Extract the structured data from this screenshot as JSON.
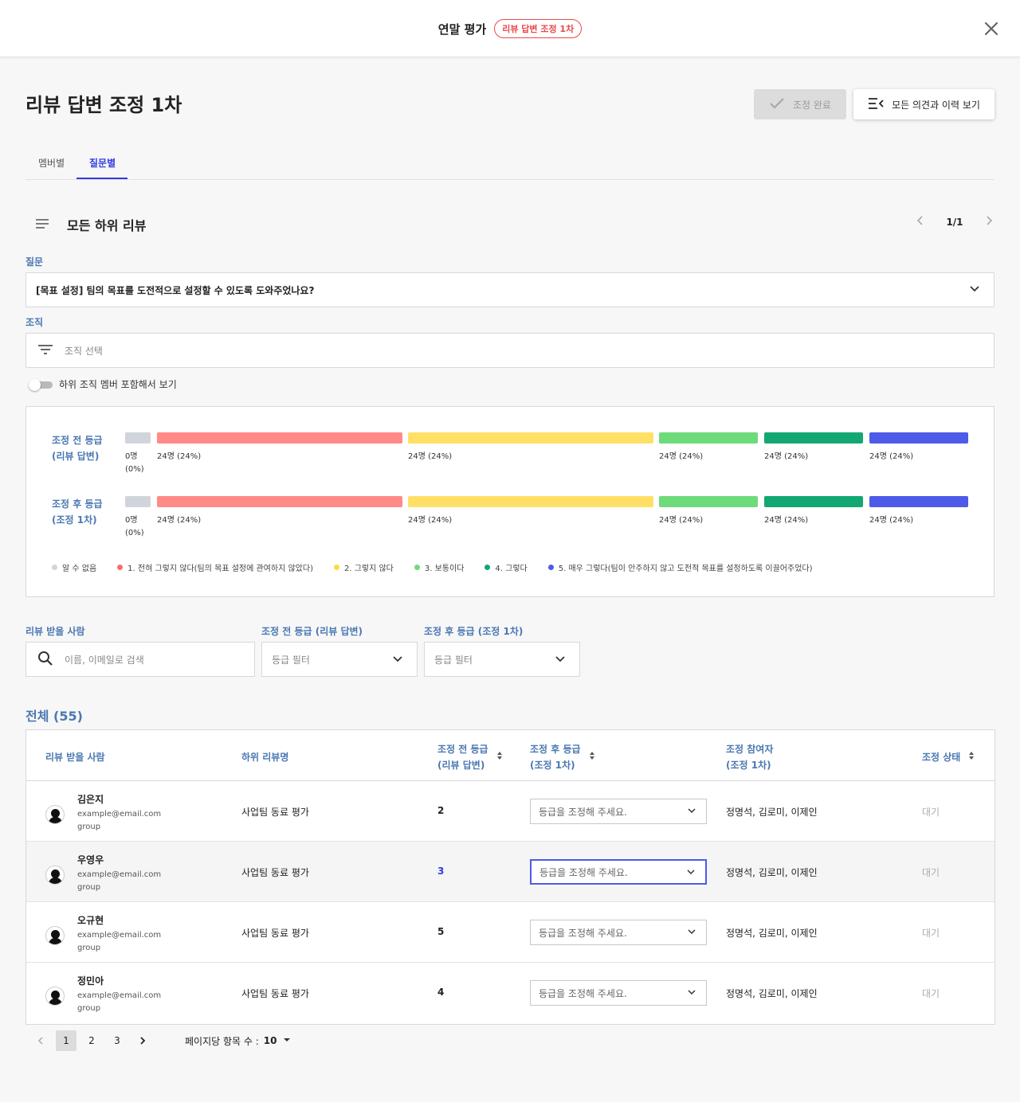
{
  "header": {
    "app_title": "연말 평가",
    "round_badge": "리뷰 답변 조정 1차"
  },
  "page": {
    "title": "리뷰 답변 조정 1차",
    "complete_button": "조정 완료",
    "history_button": "모든 의견과 이력 보기"
  },
  "tabs": [
    {
      "label": "멤버별",
      "active": false
    },
    {
      "label": "질문별",
      "active": true
    }
  ],
  "section": {
    "title": "모든 하위 리뷰",
    "pager": "1/1"
  },
  "question": {
    "label": "질문",
    "value": "[목표 설정] 팀의 목표를 도전적으로 설정할 수 있도록 도와주었나요?"
  },
  "org": {
    "label": "조직",
    "placeholder": "조직 선택",
    "toggle_label": "하위 조직 멤버 포함해서 보기",
    "toggle_on": false
  },
  "distribution": {
    "rows": [
      {
        "label_line1": "조정 전 등급",
        "label_line2": "(리뷰 답변)"
      },
      {
        "label_line1": "조정 후 등급",
        "label_line2": "(조정 1차)"
      }
    ],
    "segments": [
      {
        "label": "알 수 없음",
        "color": "#d1d5db",
        "count_label": "0명",
        "pct_label": "(0%)"
      },
      {
        "label": "1. 전혀 그렇지 않다(팀의 목표 설정에 관여하지 않았다)",
        "color": "#ff8a87",
        "count_label": "24명 (24%)"
      },
      {
        "label": "2. 그렇지 않다",
        "color": "#ffe066",
        "count_label": "24명 (24%)"
      },
      {
        "label": "3. 보통이다",
        "color": "#6edb7b",
        "count_label": "24명 (24%)"
      },
      {
        "label": "4. 그렇다",
        "color": "#13a873",
        "count_label": "24명 (24%)"
      },
      {
        "label": "5. 매우 그렇다(팀이 안주하지 않고 도전적 목표를 설정하도록 이끌어주었다)",
        "color": "#4d5be8",
        "count_label": "24명 (24%)"
      }
    ]
  },
  "filters": {
    "reviewee_label": "리뷰 받을 사람",
    "reviewee_placeholder": "이름, 이메일로 검색",
    "before_label": "조정 전 등급 (리뷰 답변)",
    "before_placeholder": "등급 필터",
    "after_label": "조정 후 등급 (조정 1차)",
    "after_placeholder": "등급 필터"
  },
  "table": {
    "total_label": "전체 (55)",
    "headers": {
      "reviewee": "리뷰 받을 사람",
      "review_name": "하위 리뷰명",
      "before_line1": "조정 전 등급",
      "before_line2": "(리뷰 답변)",
      "after_line1": "조정 후 등급",
      "after_line2": "(조정 1차)",
      "participants_line1": "조정 참여자",
      "participants_line2": "(조정 1차)",
      "status": "조정 상태"
    },
    "rows": [
      {
        "name": "김은지",
        "email": "example@email.com",
        "group": "group",
        "review": "사업팀 동료 평가",
        "grade": "2",
        "adjust_placeholder": "등급을 조정해 주세요.",
        "participants": "정명석, 김로미, 이제인",
        "status": "대기"
      },
      {
        "name": "우영우",
        "email": "example@email.com",
        "group": "group",
        "review": "사업팀 동료 평가",
        "grade": "3",
        "adjust_placeholder": "등급을 조정해 주세요.",
        "participants": "정명석, 김로미, 이제인",
        "status": "대기"
      },
      {
        "name": "오규현",
        "email": "example@email.com",
        "group": "group",
        "review": "사업팀 동료 평가",
        "grade": "5",
        "adjust_placeholder": "등급을 조정해 주세요.",
        "participants": "정명석, 김로미, 이제인",
        "status": "대기"
      },
      {
        "name": "정민아",
        "email": "example@email.com",
        "group": "group",
        "review": "사업팀 동료 평가",
        "grade": "4",
        "adjust_placeholder": "등급을 조정해 주세요.",
        "participants": "정명석, 김로미, 이제인",
        "status": "대기"
      }
    ]
  },
  "pagination": {
    "pages": [
      "1",
      "2",
      "3"
    ],
    "current": "1",
    "per_page_label": "페이지당 항목 수 :",
    "per_page_value": "10"
  }
}
